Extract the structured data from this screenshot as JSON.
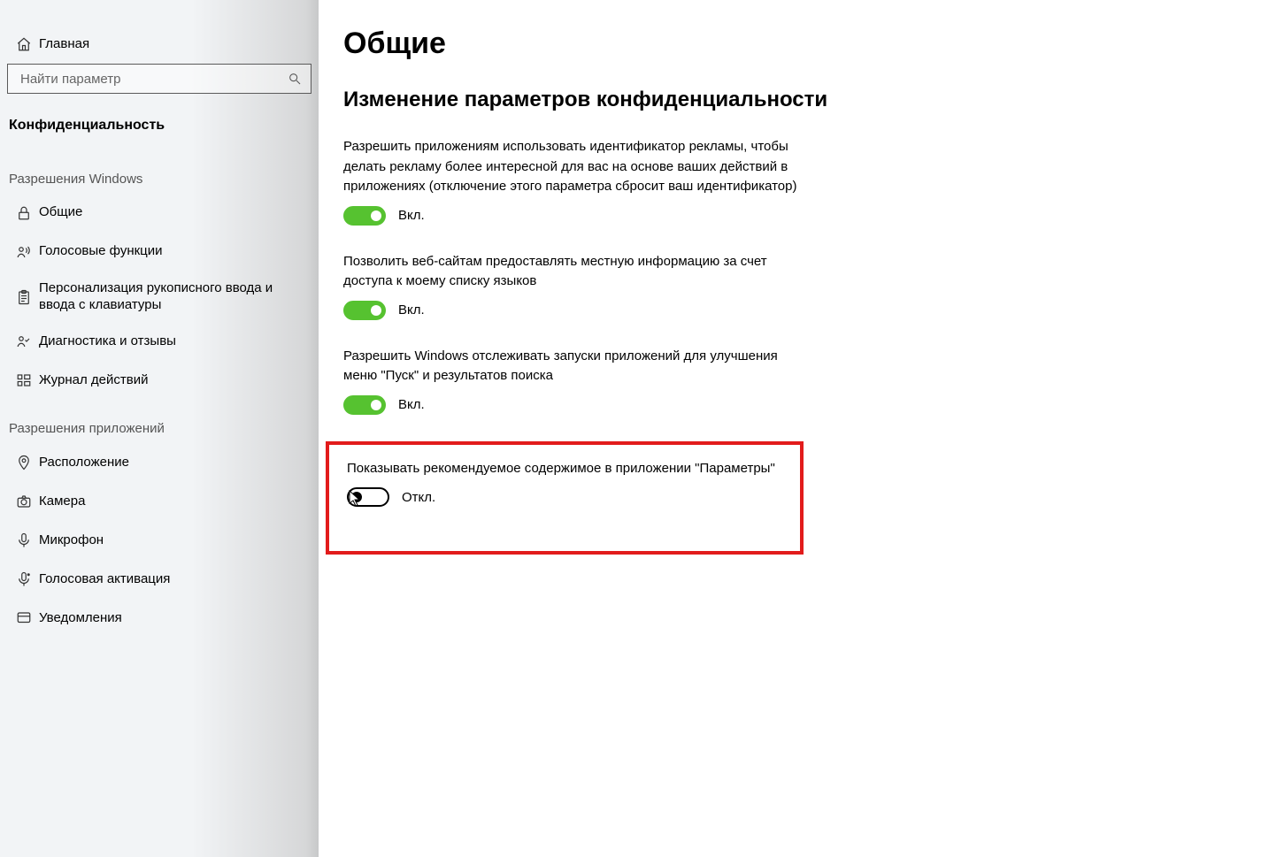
{
  "sidebar": {
    "home": "Главная",
    "search_placeholder": "Найти параметр",
    "category": "Конфиденциальность",
    "group_windows": "Разрешения Windows",
    "group_apps": "Разрешения приложений",
    "items_windows": {
      "general": "Общие",
      "voice": "Голосовые функции",
      "inking": "Персонализация рукописного ввода и ввода с клавиатуры",
      "feedback": "Диагностика и отзывы",
      "activity": "Журнал действий"
    },
    "items_apps": {
      "location": "Расположение",
      "camera": "Камера",
      "microphone": "Микрофон",
      "voice_act": "Голосовая активация",
      "notifications": "Уведомления"
    }
  },
  "main": {
    "title": "Общие",
    "section_title": "Изменение параметров конфиденциальности",
    "on_label": "Вкл.",
    "off_label": "Откл.",
    "settings": {
      "ad_id": {
        "desc": "Разрешить приложениям использовать идентификатор рекламы, чтобы делать рекламу более интересной для вас на основе ваших действий в приложениях (отключение этого параметра сбросит ваш идентификатор)",
        "state": "on"
      },
      "lang_list": {
        "desc": "Позволить веб-сайтам предоставлять местную информацию за счет доступа к моему списку языков",
        "state": "on"
      },
      "app_launch": {
        "desc": "Разрешить Windows отслеживать запуски приложений для улучшения меню \"Пуск\" и результатов поиска",
        "state": "on"
      },
      "suggested": {
        "desc": "Показывать рекомендуемое содержимое в приложении \"Параметры\"",
        "state": "off"
      }
    }
  }
}
